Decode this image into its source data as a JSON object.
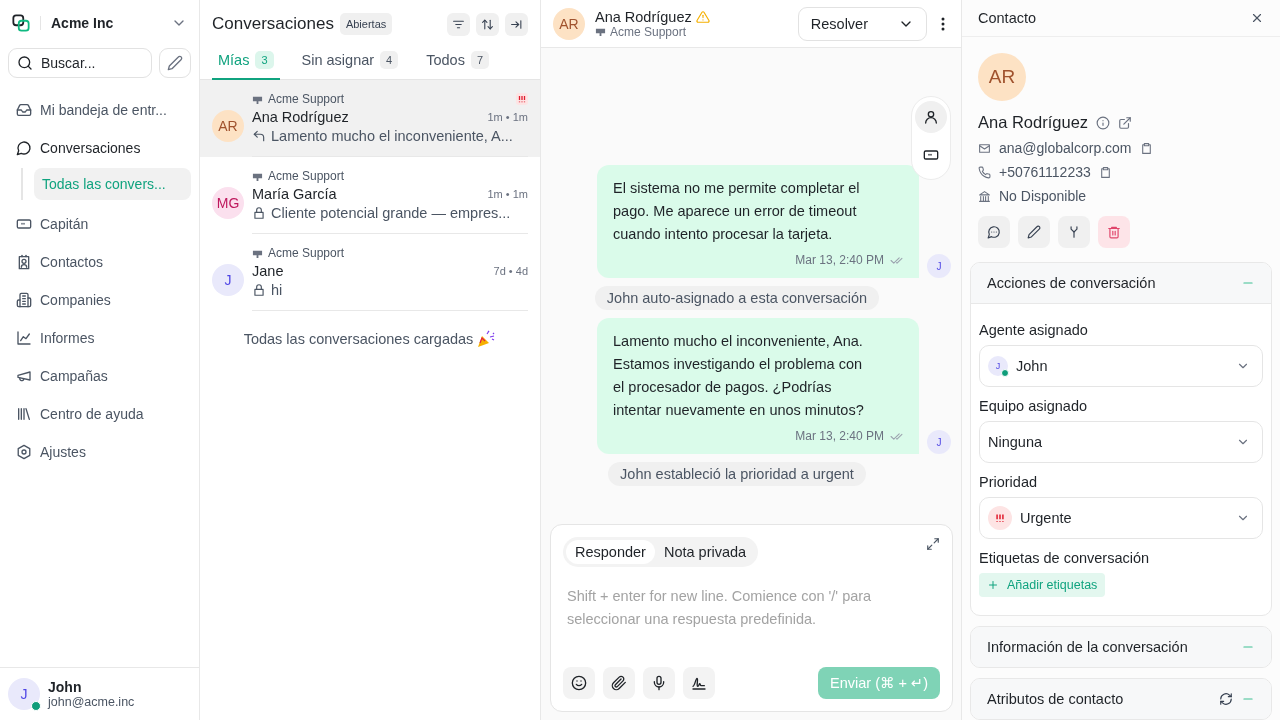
{
  "sidebar": {
    "workspace": "Acme Inc",
    "search_placeholder": "Buscar...",
    "items": [
      {
        "label": "Mi bandeja de entr...",
        "kind": "inbox",
        "selected": false
      },
      {
        "label": "Conversaciones",
        "kind": "chat",
        "selected": false,
        "children": [
          {
            "label": "Todas las convers...",
            "selected": true
          }
        ]
      },
      {
        "label": "Capitán",
        "kind": "bot",
        "selected": false
      },
      {
        "label": "Contactos",
        "kind": "contact",
        "selected": false
      },
      {
        "label": "Companies",
        "kind": "building",
        "selected": false
      },
      {
        "label": "Informes",
        "kind": "chart",
        "selected": false
      },
      {
        "label": "Campañas",
        "kind": "megaphone",
        "selected": false
      },
      {
        "label": "Centro de ayuda",
        "kind": "library",
        "selected": false
      },
      {
        "label": "Ajustes",
        "kind": "settings",
        "selected": false
      }
    ],
    "user": {
      "initials": "J",
      "name": "John",
      "email": "john@acme.inc",
      "online": true
    }
  },
  "conversations": {
    "title": "Conversaciones",
    "status": "Abiertas",
    "tabs": [
      {
        "label": "Mías",
        "count": "3",
        "selected": true
      },
      {
        "label": "Sin asignar",
        "count": "4",
        "selected": false
      },
      {
        "label": "Todos",
        "count": "7",
        "selected": false
      }
    ],
    "items": [
      {
        "inbox": "Acme Support",
        "initials": "AR",
        "color": "#fde2c4",
        "name": "Ana Rodríguez",
        "time": "1m • 1m",
        "private": false,
        "preview": "Lamento mucho el inconveniente, A...",
        "urgent": true,
        "selected": true
      },
      {
        "inbox": "Acme Support",
        "initials": "MG",
        "color": "#fbe0ee",
        "name": "María García",
        "time": "1m • 1m",
        "private": true,
        "preview": "Cliente potencial grande — empres...",
        "urgent": false,
        "selected": false
      },
      {
        "inbox": "Acme Support",
        "initials": "J",
        "color": "#e9e9fb",
        "name": "Jane",
        "time": "7d • 4d",
        "private": true,
        "preview": "hi",
        "urgent": false,
        "selected": false
      }
    ],
    "footer": "Todas las conversaciones cargadas"
  },
  "chat": {
    "initials": "AR",
    "name": "Ana Rodríguez",
    "warning": true,
    "inbox": "Acme Support",
    "resolve": "Resolver",
    "messages": [
      {
        "kind": "outgoing",
        "text": "El sistema no me permite completar el pago. Me aparece un error de timeout cuando intento procesar la tarjeta.",
        "time": "Mar 13, 2:40 PM",
        "sender": "J"
      },
      {
        "kind": "activity",
        "text": "John auto-asignado a esta conversación"
      },
      {
        "kind": "outgoing",
        "text": "Lamento mucho el inconveniente, Ana. Estamos investigando el problema con el procesador de pagos. ¿Podrías intentar nuevamente en unos minutos?",
        "time": "Mar 13, 2:40 PM",
        "sender": "J"
      },
      {
        "kind": "activity",
        "text": "John estableció la prioridad a urgent"
      }
    ],
    "composer": {
      "tabs": [
        {
          "label": "Responder",
          "selected": true
        },
        {
          "label": "Nota privada",
          "selected": false
        }
      ],
      "placeholder": "Shift + enter for new line. Comience con '/' para seleccionar una respuesta predefinida.",
      "send": "Enviar (⌘ + ↵)"
    }
  },
  "contact": {
    "title": "Contacto",
    "initials": "AR",
    "name": "Ana Rodríguez",
    "email": "ana@globalcorp.com",
    "phone": "+50761112233",
    "company": "No Disponible",
    "actions": {
      "title": "Acciones de conversación",
      "agent": {
        "label": "Agente asignado",
        "initials": "J",
        "value": "John",
        "online": true
      },
      "team": {
        "label": "Equipo asignado",
        "value": "Ninguna"
      },
      "priority": {
        "label": "Prioridad",
        "value": "Urgente",
        "kind": "urgent"
      },
      "labels": {
        "label": "Etiquetas de conversación",
        "add": "Añadir etiquetas"
      }
    },
    "sections": [
      "Información de la conversación",
      "Atributos de contacto"
    ]
  }
}
